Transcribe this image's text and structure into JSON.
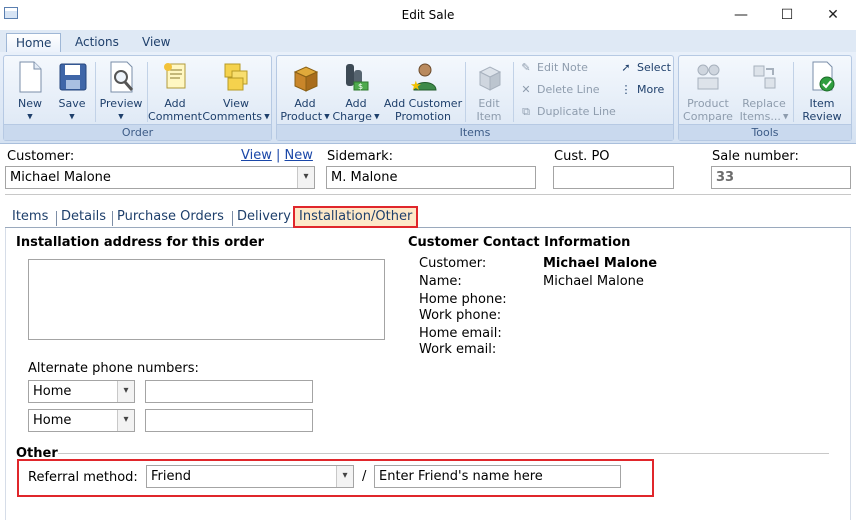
{
  "window": {
    "title": "Edit Sale",
    "minimize": "—",
    "maximize": "☐",
    "close": "✕"
  },
  "ribbon_tabs": [
    "Home",
    "Actions",
    "View"
  ],
  "ribbon": {
    "order": {
      "label": "Order",
      "new": "New",
      "save": "Save",
      "preview": "Preview",
      "add_comment_1": "Add",
      "add_comment_2": "Comment",
      "view_comments_1": "View",
      "view_comments_2": "Comments"
    },
    "items": {
      "label": "Items",
      "add_product_1": "Add",
      "add_product_2": "Product",
      "add_charge_1": "Add",
      "add_charge_2": "Charge",
      "add_customer_promotion_1": "Add Customer",
      "add_customer_promotion_2": "Promotion",
      "edit_item_1": "Edit",
      "edit_item_2": "Item",
      "edit_note": "Edit Note",
      "delete_line": "Delete Line",
      "duplicate_line": "Duplicate Line",
      "select": "Select",
      "more": "More"
    },
    "tools": {
      "label": "Tools",
      "product_compare_1": "Product",
      "product_compare_2": "Compare",
      "replace_items_1": "Replace",
      "replace_items_2": "Items...",
      "item_review_1": "Item",
      "item_review_2": "Review"
    }
  },
  "header": {
    "customer_label": "Customer:",
    "customer_value": "Michael Malone",
    "view_link": "View",
    "link_sep": "|",
    "new_link": "New",
    "sidemark_label": "Sidemark:",
    "sidemark_value": "M. Malone",
    "custpo_label": "Cust. PO",
    "custpo_value": "",
    "salenumber_label": "Sale number:",
    "salenumber_value": "33"
  },
  "tabs": [
    "Items",
    "Details",
    "Purchase Orders",
    "Delivery",
    "Installation/Other"
  ],
  "installation": {
    "address_heading": "Installation address for this order",
    "address_value": "",
    "alt_phone_label": "Alternate phone numbers:",
    "phones": [
      {
        "type": "Home",
        "number": ""
      },
      {
        "type": "Home",
        "number": ""
      }
    ]
  },
  "contact": {
    "heading": "Customer Contact Information",
    "customer_label": "Customer:",
    "customer_value": "Michael Malone",
    "name_label": "Name:",
    "name_value": "Michael Malone",
    "home_phone_label": "Home phone:",
    "work_phone_label": "Work phone:",
    "home_email_label": "Home email:",
    "work_email_label": "Work email:"
  },
  "other": {
    "heading": "Other",
    "referral_label": "Referral method:",
    "referral_value": "Friend",
    "slash": "/",
    "friend_name_value": "Enter Friend's name here"
  },
  "colors": {
    "highlight_border": "#e0262b",
    "link": "#1a47a8",
    "ribbon_text": "#1e3f6b"
  }
}
